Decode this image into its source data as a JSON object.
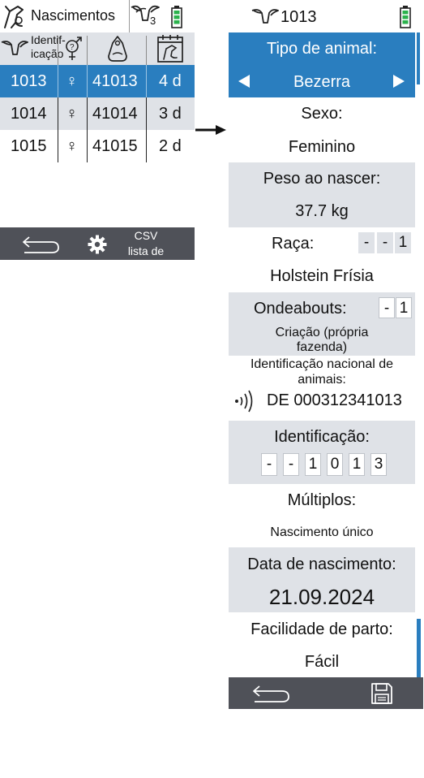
{
  "left": {
    "header": {
      "title": "Nascimentos",
      "herd_count": "3"
    },
    "columns": {
      "identification": "Identif- icação"
    },
    "rows": [
      {
        "id": "1013",
        "sex": "♀",
        "tag": "41013",
        "age": "4 d"
      },
      {
        "id": "1014",
        "sex": "♀",
        "tag": "41014",
        "age": "3 d"
      },
      {
        "id": "1015",
        "sex": "♀",
        "tag": "41015",
        "age": "2 d"
      }
    ],
    "footer": {
      "csv_label": "CSV lista de"
    }
  },
  "right": {
    "header": {
      "animal_number": "1013"
    },
    "animal_type": {
      "label": "Tipo de animal:",
      "value": "Bezerra"
    },
    "sex": {
      "label": "Sexo:",
      "value": "Feminino"
    },
    "birth_weight": {
      "label": "Peso ao nascer:",
      "value": "37.7 kg"
    },
    "breed": {
      "label": "Raça:",
      "code": [
        "-",
        "-",
        "1"
      ],
      "value": "Holstein Frísia"
    },
    "whereabouts": {
      "label": "Ondeabouts:",
      "code": [
        "-",
        "1"
      ],
      "value": "Criação (própria fazenda)"
    },
    "national_id": {
      "label": "Identificação nacional de animais:",
      "value": "DE 000312341013"
    },
    "identification": {
      "label": "Identificação:",
      "digits": [
        "-",
        "-",
        "1",
        "0",
        "1",
        "3"
      ]
    },
    "multiples": {
      "label": "Múltiplos:",
      "value": "Nascimento único"
    },
    "birth_date": {
      "label": "Data de nascimento:",
      "value": "21.09.2024"
    },
    "calving_ease": {
      "label": "Facilidade de parto:",
      "value": "Fácil"
    }
  },
  "colors": {
    "selected": "#2a7ebf",
    "row_alt": "#dfe2e7",
    "footer": "#4f5158",
    "battery": "#2bb24c"
  }
}
